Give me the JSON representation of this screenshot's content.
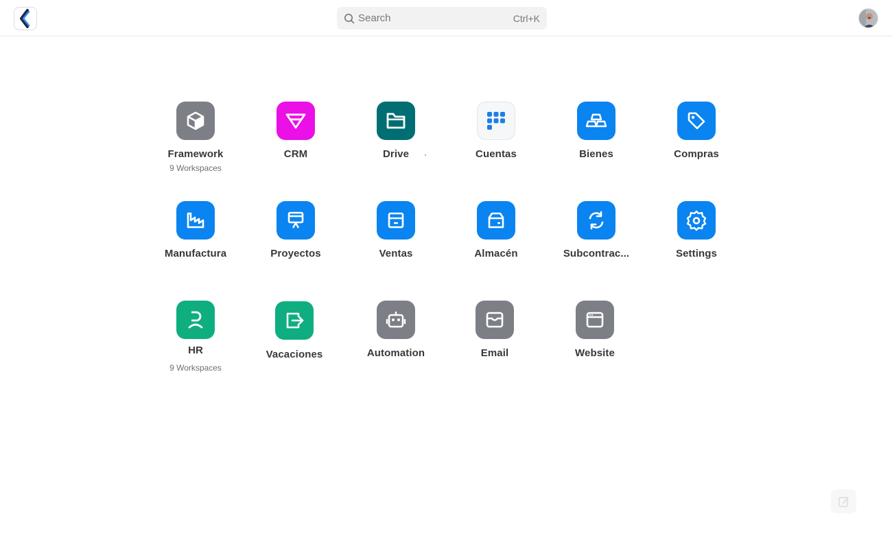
{
  "header": {
    "search": {
      "placeholder": "Search",
      "shortcut": "Ctrl+K"
    }
  },
  "apps": [
    {
      "label": "Framework",
      "sub": "9 Workspaces",
      "icon": "box-icon",
      "color": "#7d7f86"
    },
    {
      "label": "CRM",
      "sub": "",
      "icon": "crm-funnel-icon",
      "color": "#ea10e6"
    },
    {
      "label": "Drive",
      "sub": "",
      "icon": "folder-icon",
      "color": "#006e72"
    },
    {
      "label": "Cuentas",
      "sub": "",
      "icon": "apps-grid-icon",
      "color": "#f6f7f9"
    },
    {
      "label": "Bienes",
      "sub": "",
      "icon": "stacked-bars-icon",
      "color": "#0a84f0"
    },
    {
      "label": "Compras",
      "sub": "",
      "icon": "tag-icon",
      "color": "#0a84f0"
    },
    {
      "label": "Manufactura",
      "sub": "",
      "icon": "factory-icon",
      "color": "#0a84f0"
    },
    {
      "label": "Proyectos",
      "sub": "",
      "icon": "presentation-icon",
      "color": "#0a84f0"
    },
    {
      "label": "Ventas",
      "sub": "",
      "icon": "store-icon",
      "color": "#0a84f0"
    },
    {
      "label": "Almacén",
      "sub": "",
      "icon": "package-icon",
      "color": "#0a84f0"
    },
    {
      "label": "Subcontrac...",
      "sub": "",
      "icon": "refresh-icon",
      "color": "#0a84f0"
    },
    {
      "label": "Settings",
      "sub": "",
      "icon": "gear-icon",
      "color": "#0a84f0"
    },
    {
      "label": "HR",
      "sub": "9 Workspaces",
      "icon": "person-icon",
      "color": "#0fae80"
    },
    {
      "label": "Vacaciones",
      "sub": "",
      "icon": "exit-calendar-icon",
      "color": "#0fae80"
    },
    {
      "label": "Automation",
      "sub": "",
      "icon": "robot-icon",
      "color": "#7d7f86"
    },
    {
      "label": "Email",
      "sub": "",
      "icon": "inbox-icon",
      "color": "#7d7f86"
    },
    {
      "label": "Website",
      "sub": "",
      "icon": "browser-window-icon",
      "color": "#7d7f86"
    }
  ]
}
